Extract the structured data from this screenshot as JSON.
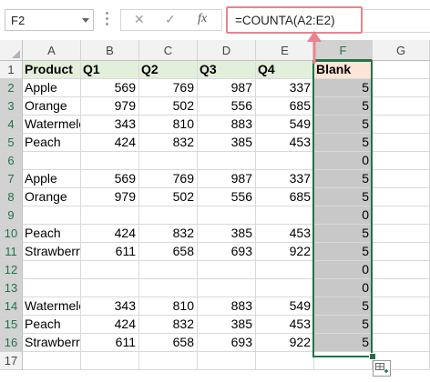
{
  "name_box": {
    "value": "F2"
  },
  "formula_bar": {
    "cancel_symbol": "✕",
    "enter_symbol": "✓",
    "fx_label": "fx",
    "formula": "=COUNTA(A2:E2)"
  },
  "columns": [
    "A",
    "B",
    "C",
    "D",
    "E",
    "F",
    "G"
  ],
  "selected_column": "F",
  "rows": [
    {
      "num": "1",
      "cells": [
        "Product",
        "Q1",
        "Q2",
        "Q3",
        "Q4",
        "Blank"
      ]
    },
    {
      "num": "2",
      "cells": [
        "Apple",
        "569",
        "769",
        "987",
        "337",
        "5"
      ]
    },
    {
      "num": "3",
      "cells": [
        "Orange",
        "979",
        "502",
        "556",
        "685",
        "5"
      ]
    },
    {
      "num": "4",
      "cells": [
        "Watermelon",
        "343",
        "810",
        "883",
        "549",
        "5"
      ]
    },
    {
      "num": "5",
      "cells": [
        "Peach",
        "424",
        "832",
        "385",
        "453",
        "5"
      ]
    },
    {
      "num": "6",
      "cells": [
        "",
        "",
        "",
        "",
        "",
        "0"
      ]
    },
    {
      "num": "7",
      "cells": [
        "Apple",
        "569",
        "769",
        "987",
        "337",
        "5"
      ]
    },
    {
      "num": "8",
      "cells": [
        "Orange",
        "979",
        "502",
        "556",
        "685",
        "5"
      ]
    },
    {
      "num": "9",
      "cells": [
        "",
        "",
        "",
        "",
        "",
        "0"
      ]
    },
    {
      "num": "10",
      "cells": [
        "Peach",
        "424",
        "832",
        "385",
        "453",
        "5"
      ]
    },
    {
      "num": "11",
      "cells": [
        "Strawberry",
        "611",
        "658",
        "693",
        "922",
        "5"
      ]
    },
    {
      "num": "12",
      "cells": [
        "",
        "",
        "",
        "",
        "",
        "0"
      ]
    },
    {
      "num": "13",
      "cells": [
        "",
        "",
        "",
        "",
        "",
        "0"
      ]
    },
    {
      "num": "14",
      "cells": [
        "Watermelon",
        "343",
        "810",
        "883",
        "549",
        "5"
      ]
    },
    {
      "num": "15",
      "cells": [
        "Peach",
        "424",
        "832",
        "385",
        "453",
        "5"
      ]
    },
    {
      "num": "16",
      "cells": [
        "Strawberry",
        "611",
        "658",
        "693",
        "922",
        "5"
      ]
    },
    {
      "num": "17",
      "cells": [
        "",
        "",
        "",
        "",
        "",
        ""
      ]
    }
  ],
  "colors": {
    "header_fill": "#e2efda",
    "blank_header_fill": "#fce4d6",
    "selection": "#217346",
    "selected_fill": "#c8c8c8",
    "arrow": "#e8848f"
  }
}
